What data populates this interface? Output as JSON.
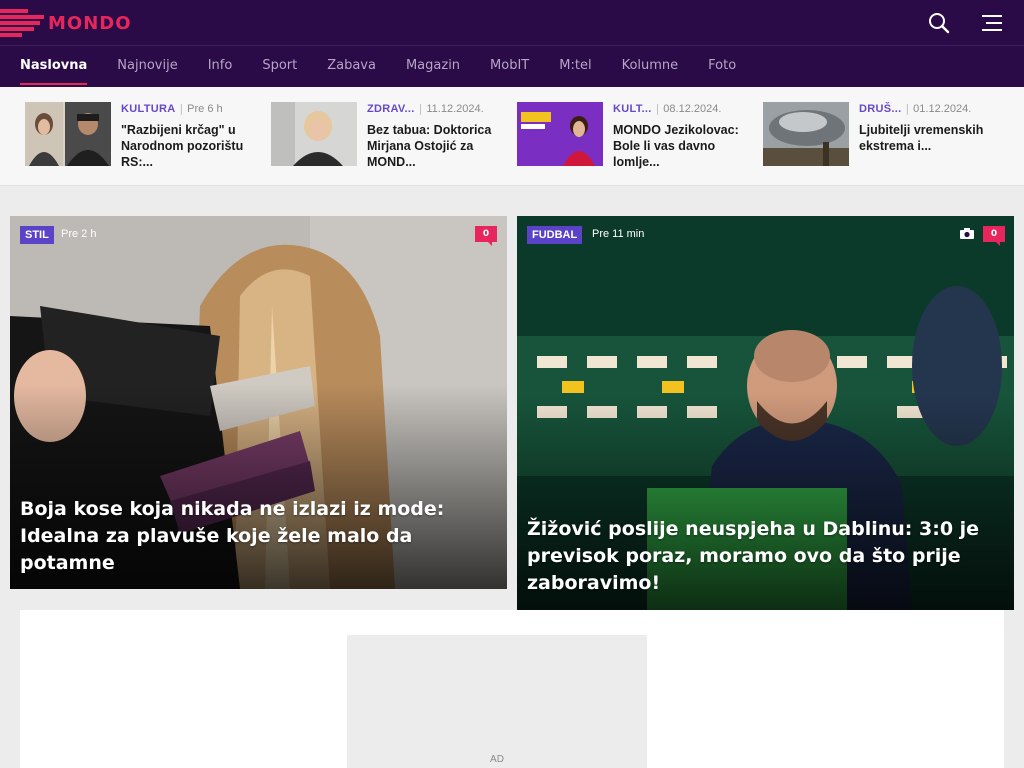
{
  "brand": {
    "logo_text": "MONDO",
    "accent": "#e8265e",
    "header_bg": "#2a0b47"
  },
  "header": {
    "search_icon": "search-icon",
    "menu_icon": "hamburger-menu-icon"
  },
  "nav": {
    "items": [
      "Naslovna",
      "Najnovije",
      "Info",
      "Sport",
      "Zabava",
      "Magazin",
      "MobIT",
      "M:tel",
      "Kolumne",
      "Foto"
    ],
    "active": "Naslovna"
  },
  "teasers": [
    {
      "category": "KULTURA",
      "time": "Pre 6 h",
      "title": "\"Razbijeni krčag\" u Narodnom pozorištu RS:..."
    },
    {
      "category": "ZDRAV...",
      "time": "11.12.2024.",
      "title": "Bez tabua: Doktorica Mirjana Ostojić za MOND..."
    },
    {
      "category": "KULT...",
      "time": "08.12.2024.",
      "title": "MONDO Jezikolovac: Bole li vas davno lomlje..."
    },
    {
      "category": "DRUŠ...",
      "time": "01.12.2024.",
      "title": "Ljubitelji vremenskih ekstrema i..."
    }
  ],
  "cards": [
    {
      "tag": "STIL",
      "time": "Pre 2 h",
      "comments": "0",
      "title": "Boja kose koja nikada ne izlazi iz mode: Idealna za plavuše koje žele malo da potamne"
    },
    {
      "tag": "FUDBAL",
      "time": "Pre 11 min",
      "comments": "0",
      "title": "Žižović poslije neuspjeha u Dablinu: 3:0 je previsok poraz, moramo ovo da što prije zaboravimo!"
    }
  ],
  "ad": {
    "label": "AD"
  }
}
